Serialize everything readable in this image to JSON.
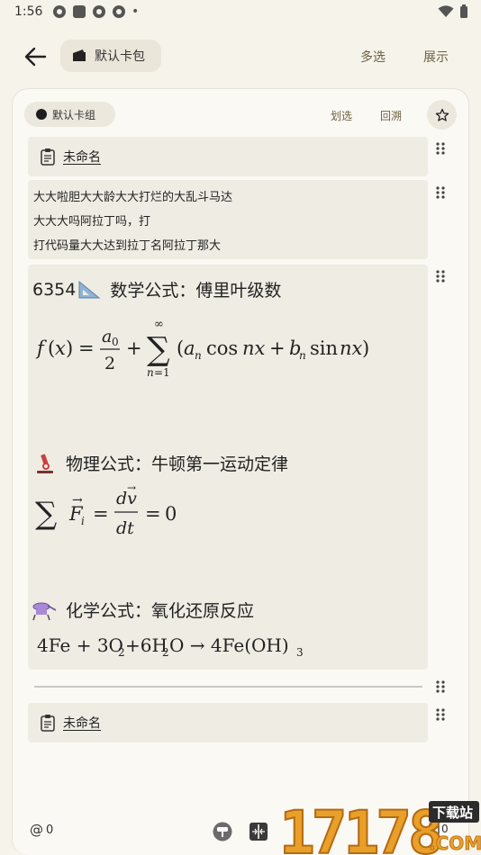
{
  "status": {
    "time": "1:56",
    "dot": "•"
  },
  "topbar": {
    "wallet_label": "默认卡包",
    "multi_select": "多选",
    "show": "展示"
  },
  "card": {
    "deck_label": "默认卡组",
    "slide": "划选",
    "trace": "回溯"
  },
  "blocks": {
    "title1": "未命名",
    "text_lines": [
      "大大啦胆大大龄大大打烂的大乱斗马达",
      "大大大吗阿拉丁吗，打",
      "打代码量大大达到拉丁名阿拉丁那大"
    ],
    "math_heading": "6354",
    "math_label": "数学公式：傅里叶级数",
    "physics_label": "物理公式：牛顿第一运动定律",
    "chem_label": "化学公式：氧化还原反应",
    "title2": "未命名"
  },
  "footer": {
    "mentions": "0",
    "count": "0"
  },
  "watermark": {
    "digits": "17178",
    "site": "下载站",
    "com": ".COM"
  }
}
